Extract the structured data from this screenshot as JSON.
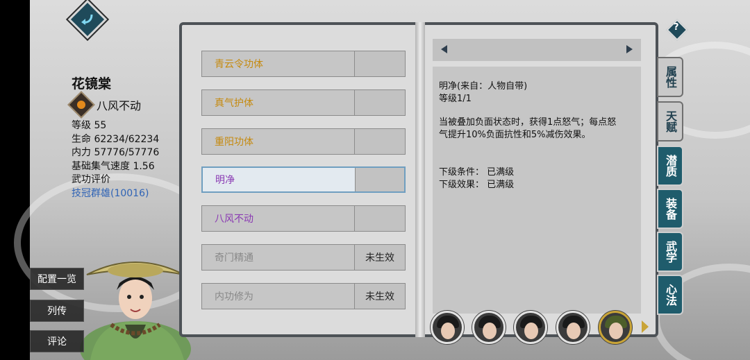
{
  "character": {
    "name": "花镜棠",
    "trait": "八风不动",
    "stats": [
      "等级 55",
      "生命 62234/62234",
      "内力 57776/57776",
      "基础集气速度 1.56",
      "武功评价"
    ],
    "rating": "技冠群雄(10016)"
  },
  "side_menu": {
    "config_label": "配置一览",
    "biography_label": "列传",
    "comment_label": "评论"
  },
  "skills": [
    {
      "name": "青云令功体",
      "status": ""
    },
    {
      "name": "真气护体",
      "status": ""
    },
    {
      "name": "重阳功体",
      "status": ""
    },
    {
      "name": "明净",
      "status": ""
    },
    {
      "name": "八风不动",
      "status": ""
    },
    {
      "name": "奇门精通",
      "status": "未生效"
    },
    {
      "name": "内功修为",
      "status": "未生效"
    }
  ],
  "detail": {
    "title_line": "明净(来自：人物自带)",
    "level_line": "等级1/1",
    "desc_line1": "当被叠加负面状态时，获得1点怒气；每点怒",
    "desc_line2": "气提升10%负面抗性和5%减伤效果。",
    "lower_condition": "下级条件：  已满级",
    "lower_effect": "下级效果：  已满级"
  },
  "tabs": [
    "属性",
    "天赋",
    "潜质",
    "装备",
    "武学",
    "心法"
  ],
  "help_label": "?",
  "colors": {
    "tab_active": "#1f5c6c",
    "gold_text": "#c58a0f",
    "purple_text": "#8a3ab3",
    "rating_blue": "#2f63b5"
  },
  "icons": [
    "back-arrow-icon",
    "trait-icon",
    "help-icon",
    "prev-arrow-icon",
    "next-arrow-icon"
  ]
}
